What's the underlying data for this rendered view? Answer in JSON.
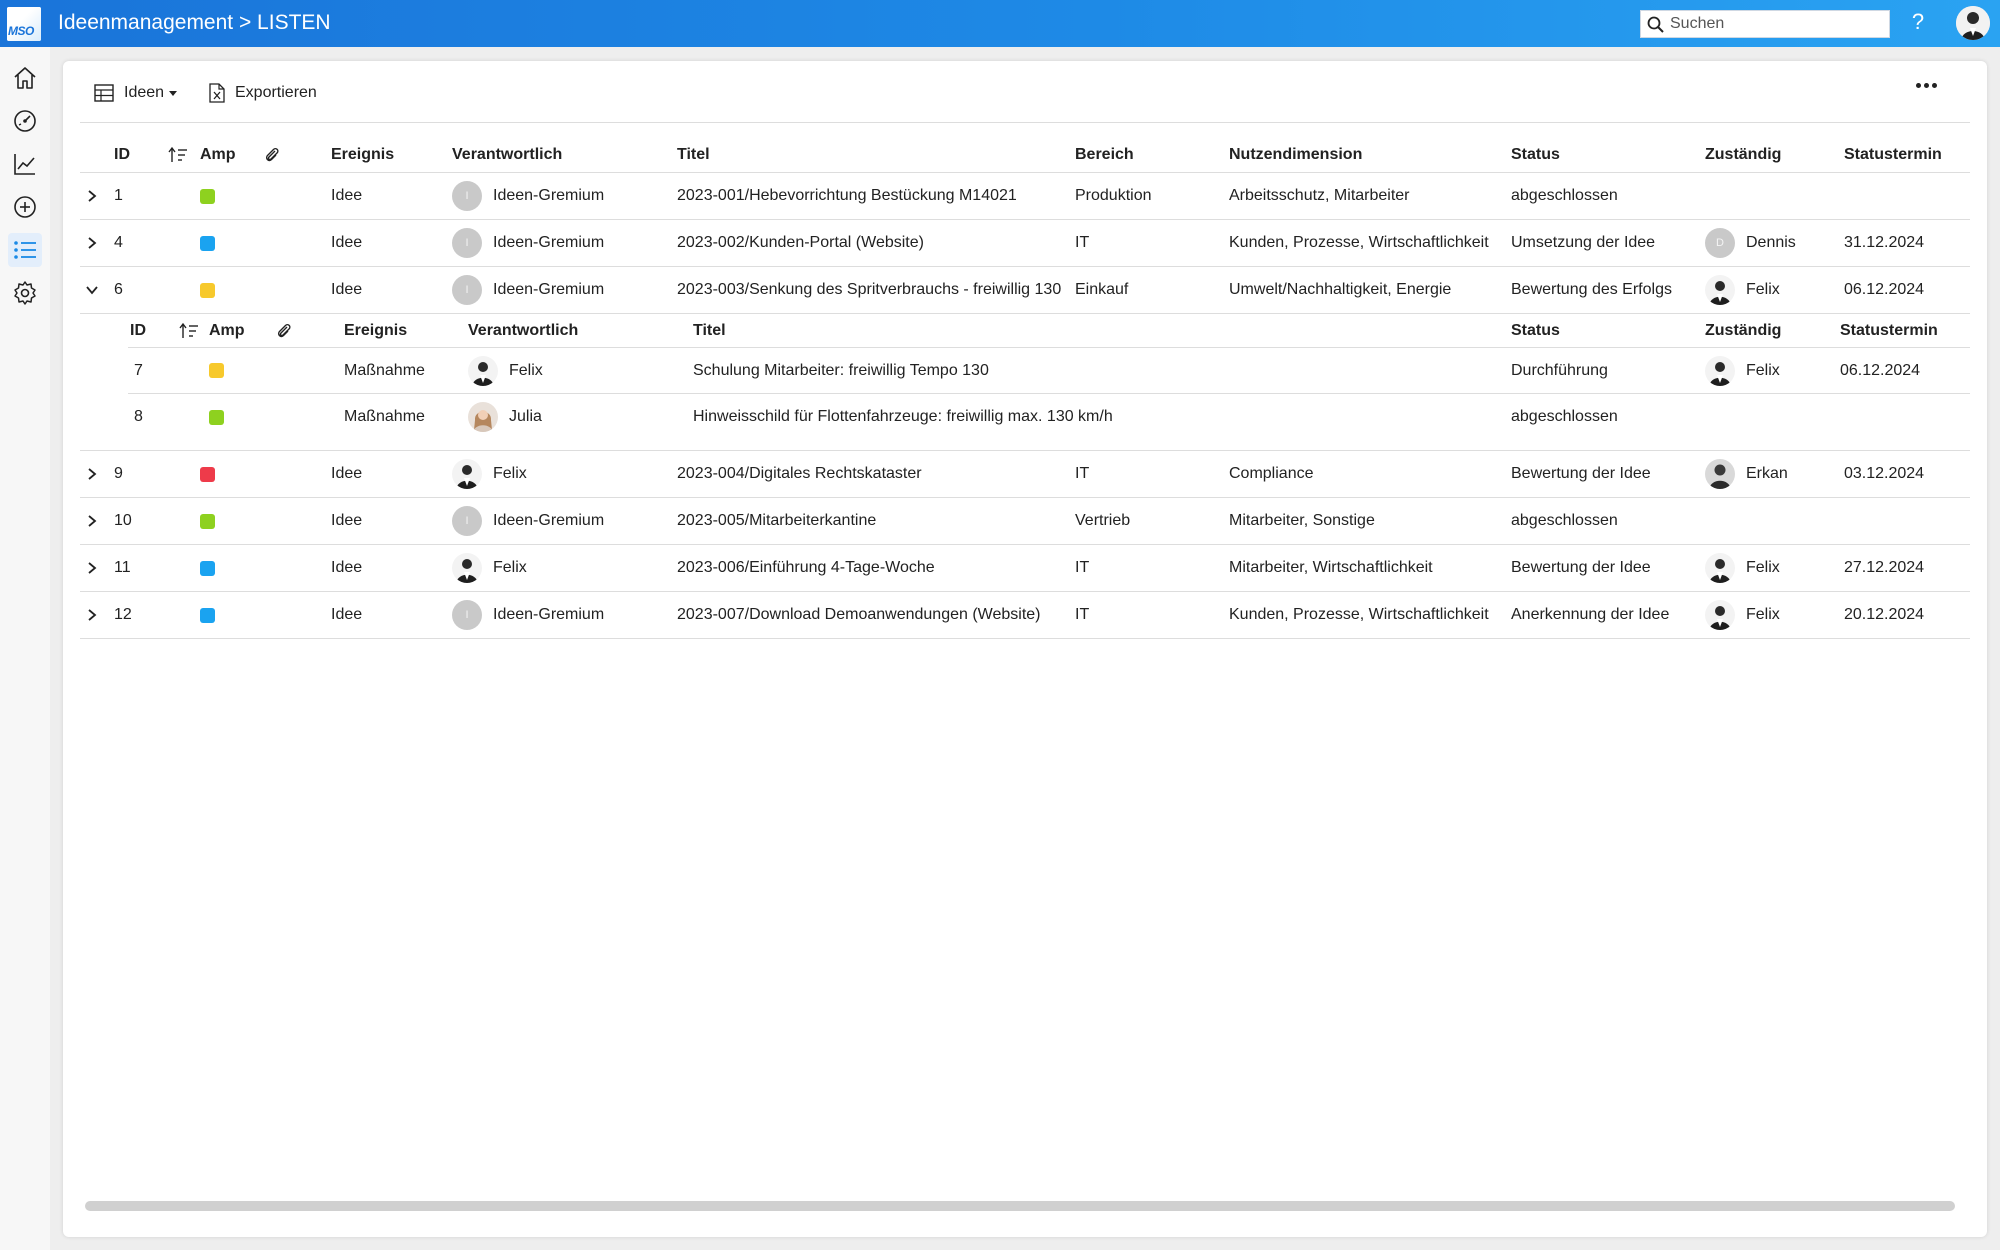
{
  "header": {
    "logo_text": "MSO",
    "title": "Ideenmanagement > LISTEN",
    "search_placeholder": "Suchen",
    "help_label": "?"
  },
  "sidebar": {
    "items": [
      {
        "icon": "home-icon"
      },
      {
        "icon": "dashboard-icon"
      },
      {
        "icon": "chart-icon"
      },
      {
        "icon": "add-icon"
      },
      {
        "icon": "list-icon",
        "active": true
      },
      {
        "icon": "settings-icon"
      }
    ]
  },
  "toolbar": {
    "view_label": "Ideen",
    "export_label": "Exportieren"
  },
  "colors": {
    "green": "#8ed11f",
    "blue": "#1aa3f0",
    "yellow": "#f7c92c",
    "red": "#ee3b4a"
  },
  "table": {
    "headers": {
      "id": "ID",
      "amp": "Amp",
      "ereignis": "Ereignis",
      "verantwortlich": "Verantwortlich",
      "titel": "Titel",
      "bereich": "Bereich",
      "nutzendimension": "Nutzendimension",
      "status": "Status",
      "zustaendig": "Zuständig",
      "statustermin": "Statustermin"
    },
    "rows": [
      {
        "id": "1",
        "amp": "green",
        "ereignis": "Idee",
        "verantwortlich": "Ideen-Gremium",
        "v_initial": "I",
        "titel": "2023-001/Hebevorrichtung Bestückung M14021",
        "bereich": "Produktion",
        "nutzendimension": "Arbeitsschutz, Mitarbeiter",
        "status": "abgeschlossen",
        "zustaendig": "",
        "statustermin": ""
      },
      {
        "id": "4",
        "amp": "blue",
        "ereignis": "Idee",
        "verantwortlich": "Ideen-Gremium",
        "v_initial": "I",
        "titel": "2023-002/Kunden-Portal (Website)",
        "bereich": "IT",
        "nutzendimension": "Kunden, Prozesse, Wirtschaftlichkeit",
        "status": "Umsetzung der Idee",
        "zustaendig": "Dennis",
        "z_initial": "D",
        "statustermin": "31.12.2024"
      },
      {
        "id": "6",
        "amp": "yellow",
        "ereignis": "Idee",
        "verantwortlich": "Ideen-Gremium",
        "v_initial": "I",
        "titel": "2023-003/Senkung des Spritverbrauchs - freiwillig 130",
        "bereich": "Einkauf",
        "nutzendimension": "Umwelt/Nachhaltigkeit, Energie",
        "status": "Bewertung des Erfolgs",
        "zustaendig": "Felix",
        "statustermin": "06.12.2024",
        "expanded": true
      },
      {
        "id": "9",
        "amp": "red",
        "ereignis": "Idee",
        "verantwortlich": "Felix",
        "titel": "2023-004/Digitales Rechtskataster",
        "bereich": "IT",
        "nutzendimension": "Compliance",
        "status": "Bewertung der Idee",
        "zustaendig": "Erkan",
        "statustermin": "03.12.2024"
      },
      {
        "id": "10",
        "amp": "green",
        "ereignis": "Idee",
        "verantwortlich": "Ideen-Gremium",
        "v_initial": "I",
        "titel": "2023-005/Mitarbeiterkantine",
        "bereich": "Vertrieb",
        "nutzendimension": "Mitarbeiter, Sonstige",
        "status": "abgeschlossen",
        "zustaendig": "",
        "statustermin": ""
      },
      {
        "id": "11",
        "amp": "blue",
        "ereignis": "Idee",
        "verantwortlich": "Felix",
        "titel": "2023-006/Einführung 4-Tage-Woche",
        "bereich": "IT",
        "nutzendimension": "Mitarbeiter, Wirtschaftlichkeit",
        "status": "Bewertung der Idee",
        "zustaendig": "Felix",
        "statustermin": "27.12.2024"
      },
      {
        "id": "12",
        "amp": "blue",
        "ereignis": "Idee",
        "verantwortlich": "Ideen-Gremium",
        "v_initial": "I",
        "titel": "2023-007/Download Demoanwendungen (Website)",
        "bereich": "IT",
        "nutzendimension": "Kunden, Prozesse, Wirtschaftlichkeit",
        "status": "Anerkennung der Idee",
        "zustaendig": "Felix",
        "statustermin": "20.12.2024"
      }
    ],
    "subtable": {
      "headers": {
        "id": "ID",
        "amp": "Amp",
        "ereignis": "Ereignis",
        "verantwortlich": "Verantwortlich",
        "titel": "Titel",
        "status": "Status",
        "zustaendig": "Zuständig",
        "statustermin": "Statustermin"
      },
      "rows": [
        {
          "id": "7",
          "amp": "yellow",
          "ereignis": "Maßnahme",
          "verantwortlich": "Felix",
          "titel": "Schulung Mitarbeiter: freiwillig Tempo 130",
          "status": "Durchführung",
          "zustaendig": "Felix",
          "statustermin": "06.12.2024"
        },
        {
          "id": "8",
          "amp": "green",
          "ereignis": "Maßnahme",
          "verantwortlich": "Julia",
          "titel": "Hinweisschild für Flottenfahrzeuge: freiwillig max. 130 km/h",
          "status": "abgeschlossen",
          "zustaendig": "",
          "statustermin": ""
        }
      ]
    }
  }
}
